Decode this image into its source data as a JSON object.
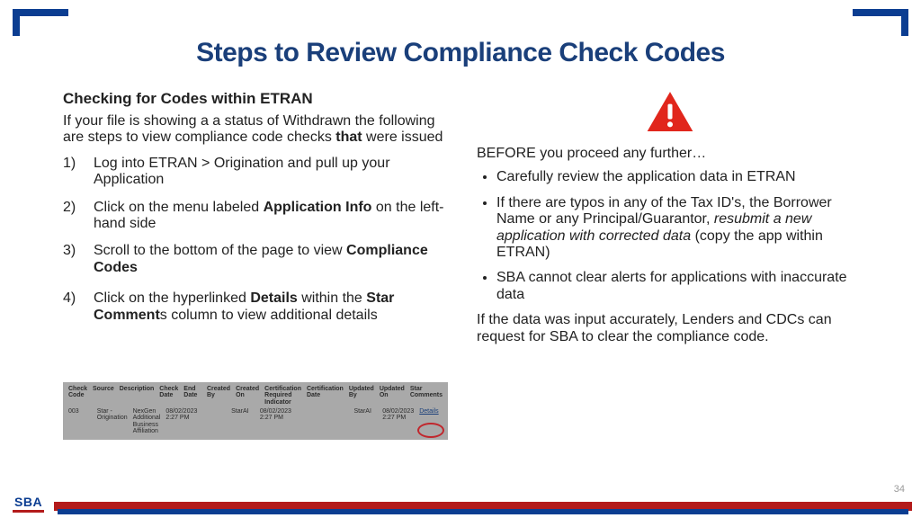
{
  "title": "Steps to Review Compliance Check Codes",
  "left": {
    "subhead": "Checking for Codes within ETRAN",
    "intro_pre": "If your file is showing a a status of Withdrawn the following are steps to view compliance code checks ",
    "intro_bold": "that",
    "intro_post": " were issued",
    "steps": {
      "s1": "Log into ETRAN > Origination and pull up your Application",
      "s2_pre": "Click on the menu labeled ",
      "s2_b": "Application Info",
      "s2_post": " on the left-hand side",
      "s3_pre": "Scroll to the bottom of the page to view ",
      "s3_b": "Compliance Codes",
      "s4_pre": "Click on the hyperlinked ",
      "s4_b1": "Details",
      "s4_mid": " within the ",
      "s4_b2": "Star Comment",
      "s4_post": "s column to view additional details"
    }
  },
  "right": {
    "lead": "BEFORE you proceed any further…",
    "b1": "Carefully review the application data in ETRAN",
    "b2_pre": "If there are typos in any of the Tax ID's, the Borrower Name or any Principal/Guarantor, ",
    "b2_em": "resubmit a new application with corrected data",
    "b2_post": " (copy the app within ETRAN)",
    "b3": "SBA cannot clear alerts for applications with inaccurate data",
    "closing": "If the data was input accurately, Lenders and CDCs can request for SBA to clear the compliance code."
  },
  "mini": {
    "headers": [
      "Check Code",
      "Source",
      "Description",
      "Check Date",
      "End Date",
      "Created By",
      "Created On",
      "Certification Required Indicator",
      "Certification Date",
      "Updated By",
      "Updated On",
      "Star Comments"
    ],
    "row": [
      "003",
      "Star - Origination",
      "NexGen Additional Business Affiliation",
      "08/02/2023 2:27 PM",
      "",
      "StarAI",
      "08/02/2023 2:27 PM",
      "",
      "",
      "StarAI",
      "08/02/2023 2:27 PM",
      "Details"
    ]
  },
  "footer": {
    "logo": "SBA",
    "page": "34"
  }
}
